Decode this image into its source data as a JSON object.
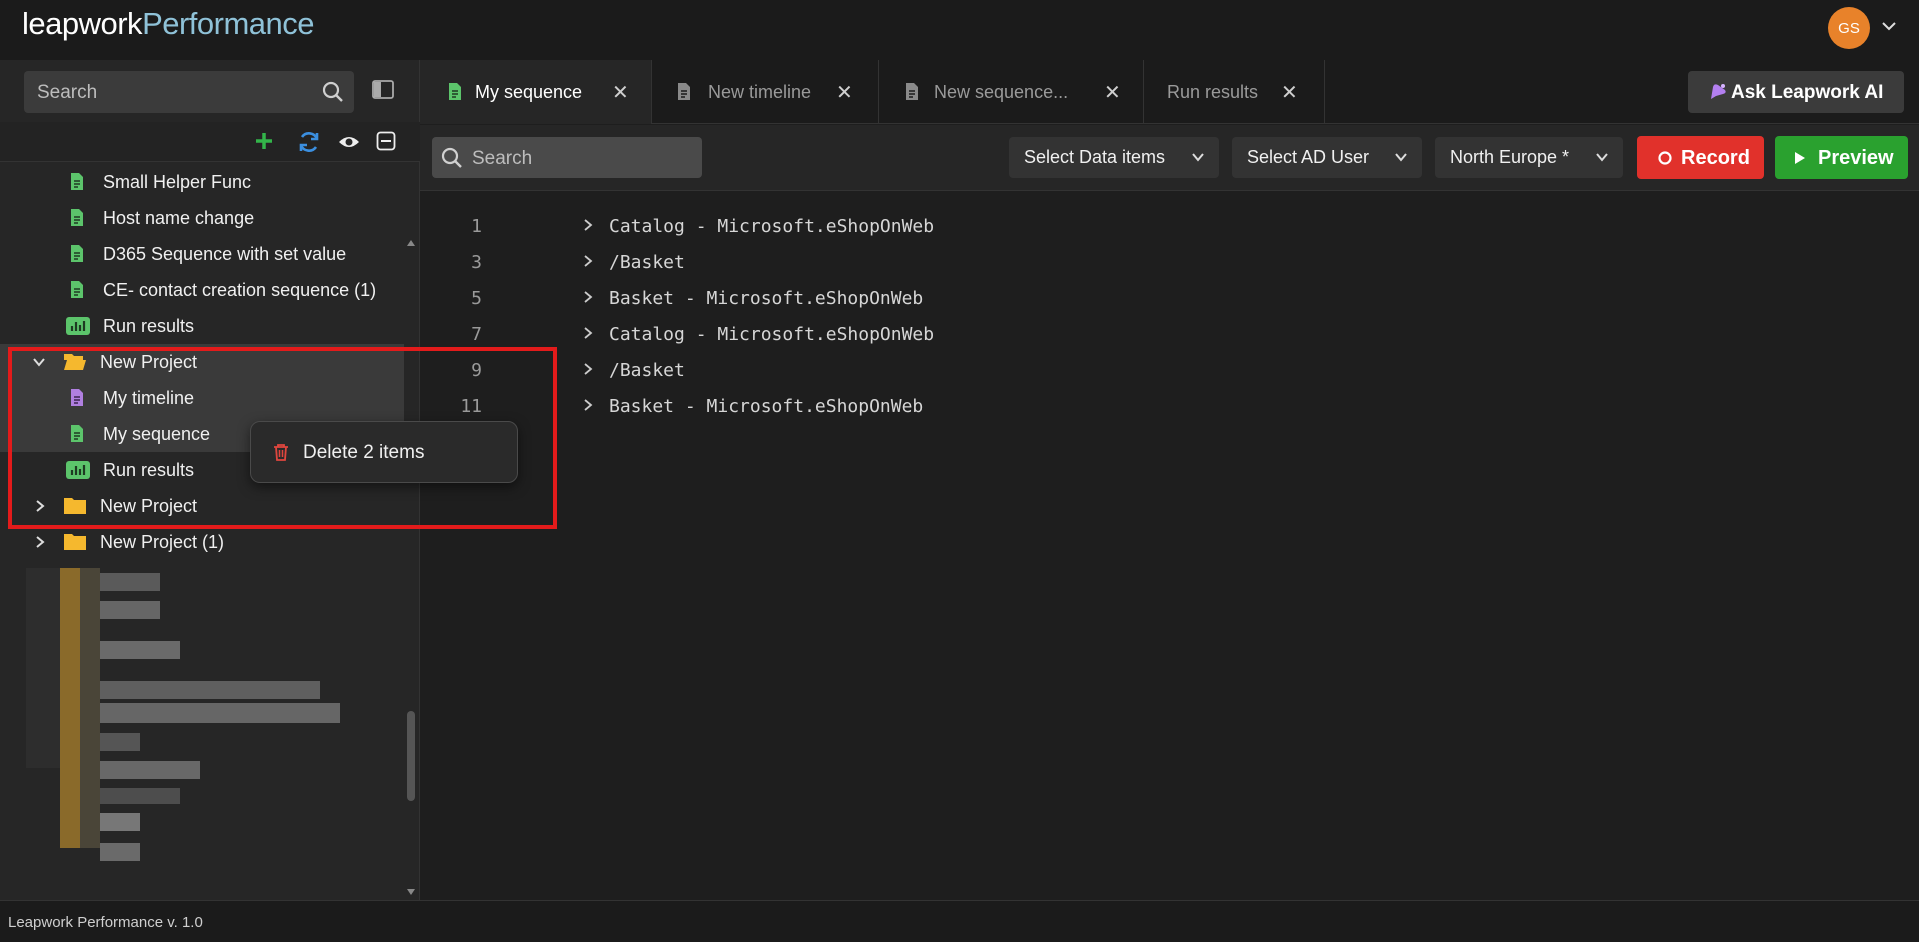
{
  "app": {
    "name_part1": "leapwork",
    "name_part2": "Performance",
    "user_initials": "GS"
  },
  "sidebar": {
    "search_placeholder": "Search",
    "tree": [
      {
        "label": "Small Helper Func",
        "type": "sequence"
      },
      {
        "label": "Host name change",
        "type": "sequence"
      },
      {
        "label": "D365 Sequence with set value",
        "type": "sequence"
      },
      {
        "label": "CE- contact creation sequence (1)",
        "type": "sequence"
      },
      {
        "label": "Run results",
        "type": "results"
      },
      {
        "label": "New Project",
        "type": "folder-open",
        "expanded": true
      },
      {
        "label": "My timeline",
        "type": "timeline",
        "selected": true
      },
      {
        "label": "My sequence",
        "type": "sequence",
        "selected": true
      },
      {
        "label": "Run results",
        "type": "results"
      },
      {
        "label": "New Project",
        "type": "folder",
        "expanded": false
      },
      {
        "label": "New Project (1)",
        "type": "folder",
        "expanded": false
      }
    ]
  },
  "tabs": [
    {
      "label": "My sequence",
      "active": true,
      "icon": "sequence-icon"
    },
    {
      "label": "New timeline",
      "active": false,
      "icon": "timeline-icon"
    },
    {
      "label": "New sequence...",
      "active": false,
      "icon": "sequence-icon"
    },
    {
      "label": "Run results",
      "active": false,
      "icon": "none"
    }
  ],
  "ai_button": "Ask Leapwork AI",
  "toolbar": {
    "search_placeholder": "Search",
    "data_items": "Select Data items",
    "ad_user": "Select AD User",
    "region": "North Europe *",
    "record": "Record",
    "preview": "Preview"
  },
  "editor_lines": [
    {
      "num": "1",
      "text": "Catalog - Microsoft.eShopOnWeb"
    },
    {
      "num": "3",
      "text": "/Basket"
    },
    {
      "num": "5",
      "text": "Basket - Microsoft.eShopOnWeb"
    },
    {
      "num": "7",
      "text": "Catalog - Microsoft.eShopOnWeb"
    },
    {
      "num": "9",
      "text": "/Basket"
    },
    {
      "num": "11",
      "text": "Basket - Microsoft.eShopOnWeb"
    }
  ],
  "context_menu": {
    "delete_label": "Delete 2 items"
  },
  "status": {
    "version": "Leapwork Performance v. 1.0"
  },
  "colors": {
    "accent_red": "#e1312b",
    "accent_green": "#2aa12f",
    "folder": "#f5b82e",
    "sequence_icon": "#5cc46b",
    "timeline_icon": "#b07fe0"
  }
}
